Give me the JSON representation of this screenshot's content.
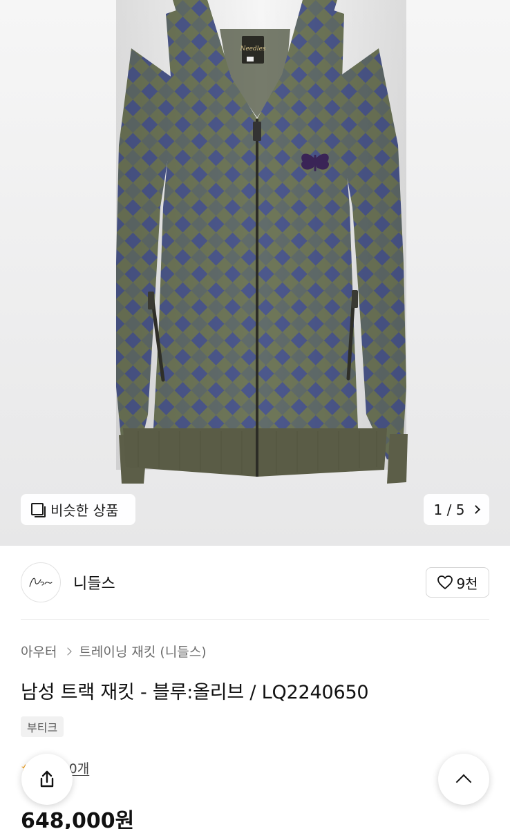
{
  "gallery": {
    "similar_label": "비슷한 상품",
    "current": "1",
    "total": "5",
    "counter_text": "1 / 5",
    "icons": {
      "similar": "overlapping-squares-icon",
      "next": "chevron-right-icon"
    }
  },
  "brand": {
    "name": "니들스",
    "logo_text": "Needles",
    "likes": "9천",
    "icons": {
      "like": "heart-outline-icon"
    }
  },
  "product": {
    "breadcrumb": [
      "아우터",
      "트레이닝 재킷 (니들스)"
    ],
    "title": "남성 트랙 재킷 - 블루:올리브 / LQ2240650",
    "tag": "부티크",
    "review_label": "후기 10개",
    "price": "648,000원"
  },
  "floating": {
    "share_icon": "share-icon",
    "top_icon": "chevron-up-icon"
  },
  "colors": {
    "jacket_olive": "#6c7456",
    "jacket_blue": "#4e5a8c",
    "rib_olive": "#5c5e48",
    "butterfly": "#3a2456"
  }
}
